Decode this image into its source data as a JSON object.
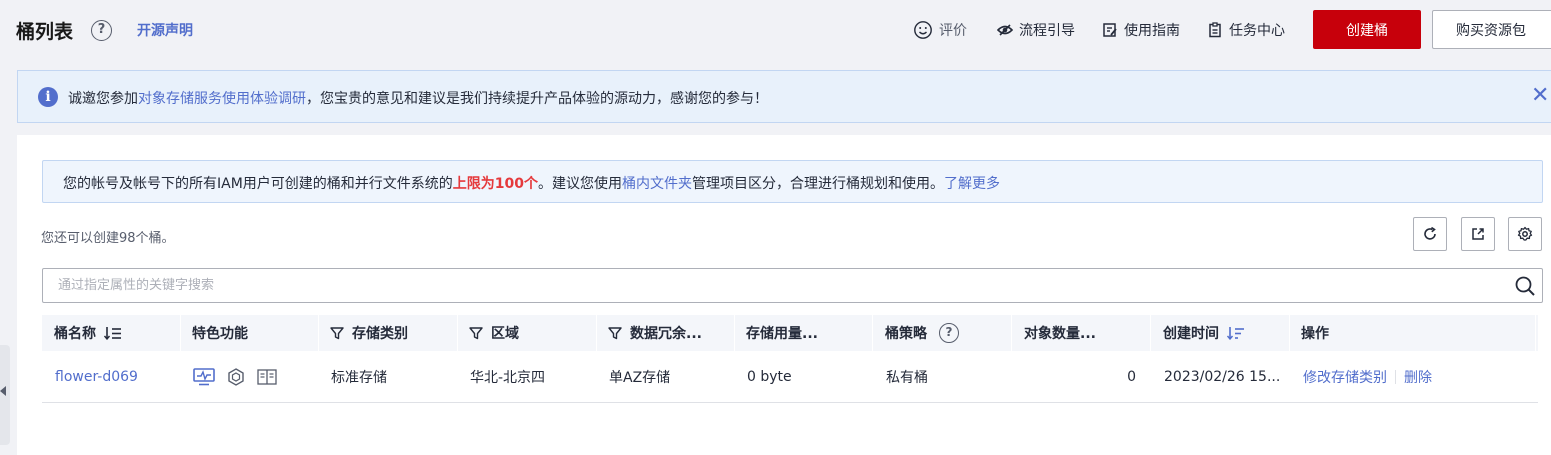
{
  "header": {
    "title": "桶列表",
    "help_symbol": "?",
    "oss_statement": "开源声明",
    "rate": "评价",
    "flow_guide": "流程引导",
    "user_guide": "使用指南",
    "task_center": "任务中心",
    "create_bucket": "创建桶",
    "buy_package": "购买资源包"
  },
  "notice": {
    "icon": "i",
    "text_before": "诚邀您参加",
    "link": "对象存储服务使用体验调研",
    "text_after": "，您宝贵的意见和建议是我们持续提升产品体验的源动力，感谢您的参与！",
    "close": "✕"
  },
  "info": {
    "text1": "您的帐号及帐号下的所有IAM用户可创建的桶和并行文件系统的",
    "limit": "上限为100个",
    "text2": "。建议您使用",
    "folder_link": "桶内文件夹",
    "text3": "管理项目区分，合理进行桶规划和使用。",
    "learn_more": "了解更多"
  },
  "remaining": "您还可以创建98个桶。",
  "search": {
    "placeholder": "通过指定属性的关键字搜索"
  },
  "table": {
    "headers": {
      "name": "桶名称",
      "features": "特色功能",
      "storage_class": "存储类别",
      "region": "区域",
      "redundancy": "数据冗余...",
      "usage": "存储用量...",
      "policy": "桶策略",
      "objects": "对象数量...",
      "created": "创建时间",
      "actions": "操作"
    },
    "rows": [
      {
        "name": "flower-d069",
        "storage_class": "标准存储",
        "region": "华北-北京四",
        "redundancy": "单AZ存储",
        "usage": "0 byte",
        "policy": "私有桶",
        "objects": "0",
        "created": "2023/02/26 15...",
        "action_modify": "修改存储类别",
        "action_delete": "删除"
      }
    ]
  },
  "colors": {
    "primary": "#c7000b",
    "link": "#526ecc",
    "danger_text": "#e5393c",
    "notice_bg": "#e8f1fb"
  }
}
